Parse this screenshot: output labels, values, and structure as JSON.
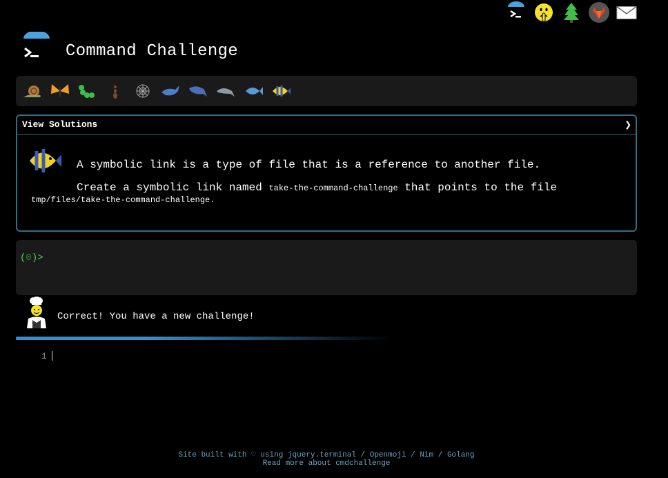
{
  "header": {
    "title": "Command Challenge"
  },
  "topnav": {
    "icons": [
      "terminal-icon",
      "shushing-face-icon",
      "tree-icon",
      "gitlab-icon",
      "mail-icon"
    ]
  },
  "badges": [
    "snail-icon",
    "butterfly-icon",
    "caterpillar-icon",
    "ant-icon",
    "spider-web-icon",
    "whale-icon",
    "shark-icon",
    "dolphin-icon",
    "fish-icon",
    "tropical-fish-icon"
  ],
  "panel": {
    "toggle_label": "View Solutions",
    "chevron": "❯",
    "line1": "A symbolic link is a type of file that is a reference to another file.",
    "line2_prefix": "Create a symbolic link named ",
    "line2_code": "take-the-command-challenge",
    "line2_suffix": " that points to the file",
    "line3_code": "tmp/files/take-the-command-challenge",
    "line3_suffix": "."
  },
  "terminal": {
    "prompt_open": "(",
    "prompt_code": "0",
    "prompt_close": ")>"
  },
  "result": {
    "message": "Correct! You have a new challenge!"
  },
  "progress": {
    "fraction": 0.6
  },
  "editor": {
    "line_number": "1"
  },
  "footer": {
    "line1": "Site built with ♡ using jquery.terminal / Openmoji / Nim / Golang",
    "line2": "Read more about cmdchallenge"
  },
  "colors": {
    "accent": "#2f6f86",
    "prompt": "#4bd24b",
    "link": "#6aa3c2"
  }
}
